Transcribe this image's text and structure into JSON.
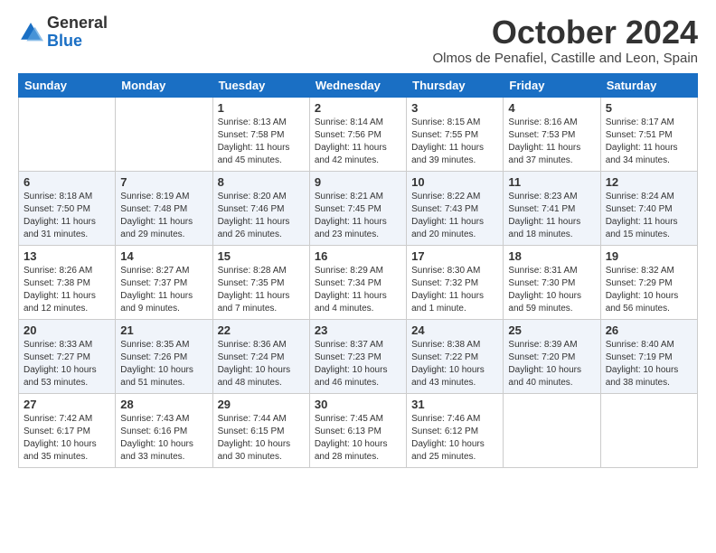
{
  "logo": {
    "general": "General",
    "blue": "Blue"
  },
  "header": {
    "month": "October 2024",
    "location": "Olmos de Penafiel, Castille and Leon, Spain"
  },
  "weekdays": [
    "Sunday",
    "Monday",
    "Tuesday",
    "Wednesday",
    "Thursday",
    "Friday",
    "Saturday"
  ],
  "weeks": [
    [
      {
        "day": "",
        "info": ""
      },
      {
        "day": "",
        "info": ""
      },
      {
        "day": "1",
        "info": "Sunrise: 8:13 AM\nSunset: 7:58 PM\nDaylight: 11 hours and 45 minutes."
      },
      {
        "day": "2",
        "info": "Sunrise: 8:14 AM\nSunset: 7:56 PM\nDaylight: 11 hours and 42 minutes."
      },
      {
        "day": "3",
        "info": "Sunrise: 8:15 AM\nSunset: 7:55 PM\nDaylight: 11 hours and 39 minutes."
      },
      {
        "day": "4",
        "info": "Sunrise: 8:16 AM\nSunset: 7:53 PM\nDaylight: 11 hours and 37 minutes."
      },
      {
        "day": "5",
        "info": "Sunrise: 8:17 AM\nSunset: 7:51 PM\nDaylight: 11 hours and 34 minutes."
      }
    ],
    [
      {
        "day": "6",
        "info": "Sunrise: 8:18 AM\nSunset: 7:50 PM\nDaylight: 11 hours and 31 minutes."
      },
      {
        "day": "7",
        "info": "Sunrise: 8:19 AM\nSunset: 7:48 PM\nDaylight: 11 hours and 29 minutes."
      },
      {
        "day": "8",
        "info": "Sunrise: 8:20 AM\nSunset: 7:46 PM\nDaylight: 11 hours and 26 minutes."
      },
      {
        "day": "9",
        "info": "Sunrise: 8:21 AM\nSunset: 7:45 PM\nDaylight: 11 hours and 23 minutes."
      },
      {
        "day": "10",
        "info": "Sunrise: 8:22 AM\nSunset: 7:43 PM\nDaylight: 11 hours and 20 minutes."
      },
      {
        "day": "11",
        "info": "Sunrise: 8:23 AM\nSunset: 7:41 PM\nDaylight: 11 hours and 18 minutes."
      },
      {
        "day": "12",
        "info": "Sunrise: 8:24 AM\nSunset: 7:40 PM\nDaylight: 11 hours and 15 minutes."
      }
    ],
    [
      {
        "day": "13",
        "info": "Sunrise: 8:26 AM\nSunset: 7:38 PM\nDaylight: 11 hours and 12 minutes."
      },
      {
        "day": "14",
        "info": "Sunrise: 8:27 AM\nSunset: 7:37 PM\nDaylight: 11 hours and 9 minutes."
      },
      {
        "day": "15",
        "info": "Sunrise: 8:28 AM\nSunset: 7:35 PM\nDaylight: 11 hours and 7 minutes."
      },
      {
        "day": "16",
        "info": "Sunrise: 8:29 AM\nSunset: 7:34 PM\nDaylight: 11 hours and 4 minutes."
      },
      {
        "day": "17",
        "info": "Sunrise: 8:30 AM\nSunset: 7:32 PM\nDaylight: 11 hours and 1 minute."
      },
      {
        "day": "18",
        "info": "Sunrise: 8:31 AM\nSunset: 7:30 PM\nDaylight: 10 hours and 59 minutes."
      },
      {
        "day": "19",
        "info": "Sunrise: 8:32 AM\nSunset: 7:29 PM\nDaylight: 10 hours and 56 minutes."
      }
    ],
    [
      {
        "day": "20",
        "info": "Sunrise: 8:33 AM\nSunset: 7:27 PM\nDaylight: 10 hours and 53 minutes."
      },
      {
        "day": "21",
        "info": "Sunrise: 8:35 AM\nSunset: 7:26 PM\nDaylight: 10 hours and 51 minutes."
      },
      {
        "day": "22",
        "info": "Sunrise: 8:36 AM\nSunset: 7:24 PM\nDaylight: 10 hours and 48 minutes."
      },
      {
        "day": "23",
        "info": "Sunrise: 8:37 AM\nSunset: 7:23 PM\nDaylight: 10 hours and 46 minutes."
      },
      {
        "day": "24",
        "info": "Sunrise: 8:38 AM\nSunset: 7:22 PM\nDaylight: 10 hours and 43 minutes."
      },
      {
        "day": "25",
        "info": "Sunrise: 8:39 AM\nSunset: 7:20 PM\nDaylight: 10 hours and 40 minutes."
      },
      {
        "day": "26",
        "info": "Sunrise: 8:40 AM\nSunset: 7:19 PM\nDaylight: 10 hours and 38 minutes."
      }
    ],
    [
      {
        "day": "27",
        "info": "Sunrise: 7:42 AM\nSunset: 6:17 PM\nDaylight: 10 hours and 35 minutes."
      },
      {
        "day": "28",
        "info": "Sunrise: 7:43 AM\nSunset: 6:16 PM\nDaylight: 10 hours and 33 minutes."
      },
      {
        "day": "29",
        "info": "Sunrise: 7:44 AM\nSunset: 6:15 PM\nDaylight: 10 hours and 30 minutes."
      },
      {
        "day": "30",
        "info": "Sunrise: 7:45 AM\nSunset: 6:13 PM\nDaylight: 10 hours and 28 minutes."
      },
      {
        "day": "31",
        "info": "Sunrise: 7:46 AM\nSunset: 6:12 PM\nDaylight: 10 hours and 25 minutes."
      },
      {
        "day": "",
        "info": ""
      },
      {
        "day": "",
        "info": ""
      }
    ]
  ]
}
